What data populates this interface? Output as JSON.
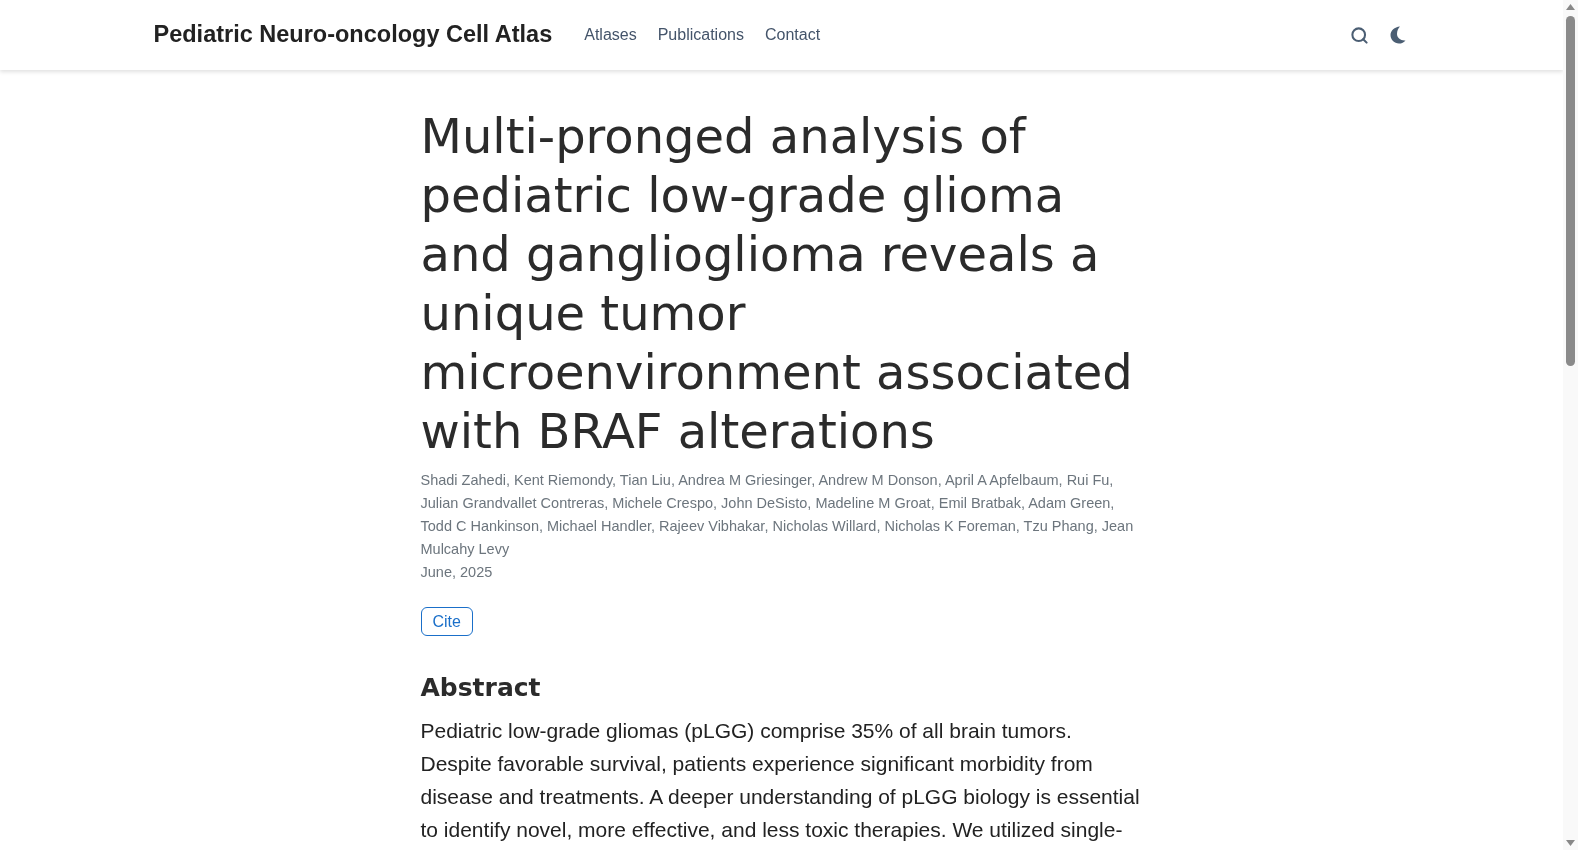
{
  "header": {
    "brand": "Pediatric Neuro-oncology Cell Atlas",
    "nav": [
      {
        "label": "Atlases"
      },
      {
        "label": "Publications"
      },
      {
        "label": "Contact"
      }
    ]
  },
  "article": {
    "title": "Multi-pronged analysis of pediatric low-grade glioma and ganglioglioma reveals a unique tumor microenvironment associated with BRAF alterations",
    "authors": "Shadi Zahedi, Kent Riemondy, Tian Liu, Andrea M Griesinger, Andrew M Donson, April A Apfelbaum, Rui Fu, Julian Grandvallet Contreras, Michele Crespo, John DeSisto, Madeline M Groat, Emil Bratbak, Adam Green, Todd C Hankinson, Michael Handler, Rajeev Vibhakar, Nicholas Willard, Nicholas K Foreman, Tzu Phang, Jean Mulcahy Levy",
    "date": "June, 2025",
    "cite_button": "Cite",
    "abstract": {
      "heading": "Abstract",
      "text": "Pediatric low-grade gliomas (pLGG) comprise 35% of all brain tumors. Despite favorable survival, patients experience significant morbidity from disease and treatments. A deeper understanding of pLGG biology is essential to identify novel, more effective, and less toxic therapies. We utilized single-"
    }
  }
}
